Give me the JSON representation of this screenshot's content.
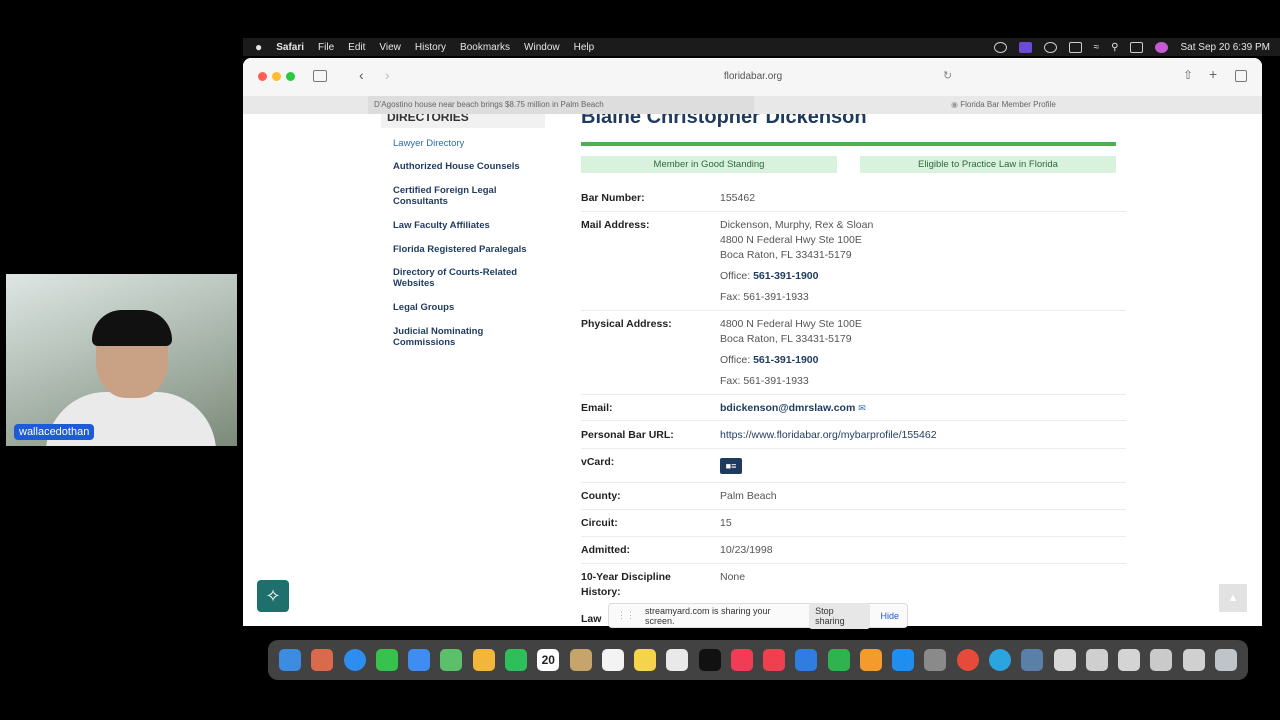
{
  "menubar": {
    "app": "Safari",
    "items": [
      "File",
      "Edit",
      "View",
      "History",
      "Bookmarks",
      "Window",
      "Help"
    ],
    "clock": "Sat Sep 20  6:39 PM"
  },
  "browser": {
    "url": "floridabar.org",
    "tabs": [
      "D'Agostino house near beach brings $8.75 million in Palm Beach",
      "Florida Bar Member Profile"
    ]
  },
  "sidebar": {
    "heading": "DIRECTORIES",
    "links": [
      "Lawyer Directory",
      "Authorized House Counsels",
      "Certified Foreign Legal Consultants",
      "Law Faculty Affiliates",
      "Florida Registered Paralegals",
      "Directory of Courts-Related Websites",
      "Legal Groups",
      "Judicial Nominating Commissions"
    ]
  },
  "profile": {
    "name": "Blaine Christopher Dickenson",
    "badges": [
      "Member in Good Standing",
      "Eligible to Practice Law in Florida"
    ],
    "bar_number_label": "Bar Number:",
    "bar_number": "155462",
    "mail_label": "Mail Address:",
    "mail_lines": [
      "Dickenson, Murphy, Rex & Sloan",
      "4800 N Federal Hwy Ste 100E",
      "Boca Raton, FL 33431-5179"
    ],
    "office_label": "Office:",
    "office_phone": "561-391-1900",
    "fax": "Fax: 561-391-1933",
    "physical_label": "Physical Address:",
    "physical_lines": [
      "4800 N Federal Hwy Ste 100E",
      "Boca Raton, FL 33431-5179"
    ],
    "email_label": "Email:",
    "email": "bdickenson@dmrslaw.com",
    "url_label": "Personal Bar URL:",
    "url": "https://www.floridabar.org/mybarprofile/155462",
    "vcard_label": "vCard:",
    "county_label": "County:",
    "county": "Palm Beach",
    "circuit_label": "Circuit:",
    "circuit": "15",
    "admitted_label": "Admitted:",
    "admitted": "10/23/1998",
    "discipline_label": "10-Year Discipline History:",
    "discipline": "None",
    "cut_label": "Law S"
  },
  "webcam": {
    "name": "wallacedothan"
  },
  "sharing": {
    "message": "streamyard.com is sharing your screen.",
    "stop": "Stop sharing",
    "hide": "Hide"
  },
  "dock": {
    "calendar_day": "20"
  }
}
